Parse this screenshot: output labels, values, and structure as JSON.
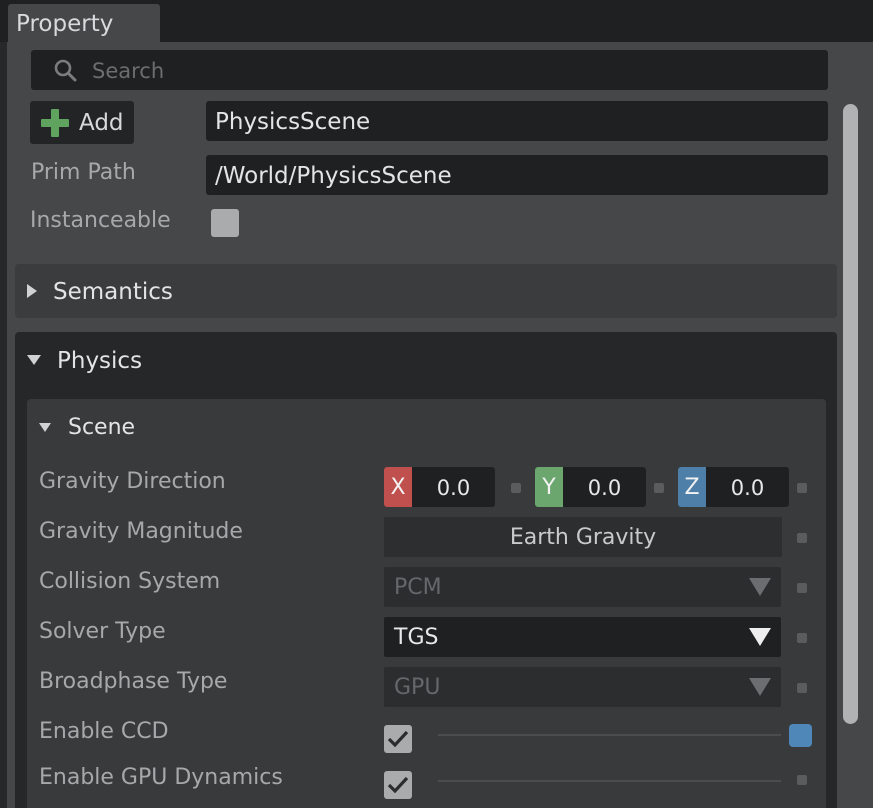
{
  "panel": {
    "tab_title": "Property"
  },
  "search": {
    "placeholder": "Search",
    "icon": "search-icon"
  },
  "header": {
    "add_label": "Add",
    "prim_name": "PhysicsScene",
    "prim_path_label": "Prim Path",
    "prim_path": "/World/PhysicsScene",
    "instanceable_label": "Instanceable",
    "instanceable": false
  },
  "sections": {
    "semantics": {
      "label": "Semantics",
      "expanded": false
    },
    "physics": {
      "label": "Physics",
      "expanded": true
    },
    "scene": {
      "label": "Scene",
      "expanded": true
    }
  },
  "scene": {
    "gravity_direction": {
      "label": "Gravity Direction",
      "x_axis": "X",
      "x": "0.0",
      "y_axis": "Y",
      "y": "0.0",
      "z_axis": "Z",
      "z": "0.0"
    },
    "gravity_magnitude": {
      "label": "Gravity Magnitude",
      "button": "Earth Gravity"
    },
    "collision_system": {
      "label": "Collision System",
      "value": "PCM",
      "enabled": false
    },
    "solver_type": {
      "label": "Solver Type",
      "value": "TGS",
      "enabled": true
    },
    "broadphase_type": {
      "label": "Broadphase Type",
      "value": "GPU",
      "enabled": false
    },
    "enable_ccd": {
      "label": "Enable CCD",
      "checked": true
    },
    "enable_gpu_dynamics": {
      "label": "Enable GPU Dynamics",
      "checked": true
    }
  },
  "colors": {
    "axis_x": "#c0504d",
    "axis_y": "#6aa66e",
    "axis_z": "#4e7fa8",
    "accent_blue": "#4e87b8",
    "plus_green": "#5fa35f"
  }
}
